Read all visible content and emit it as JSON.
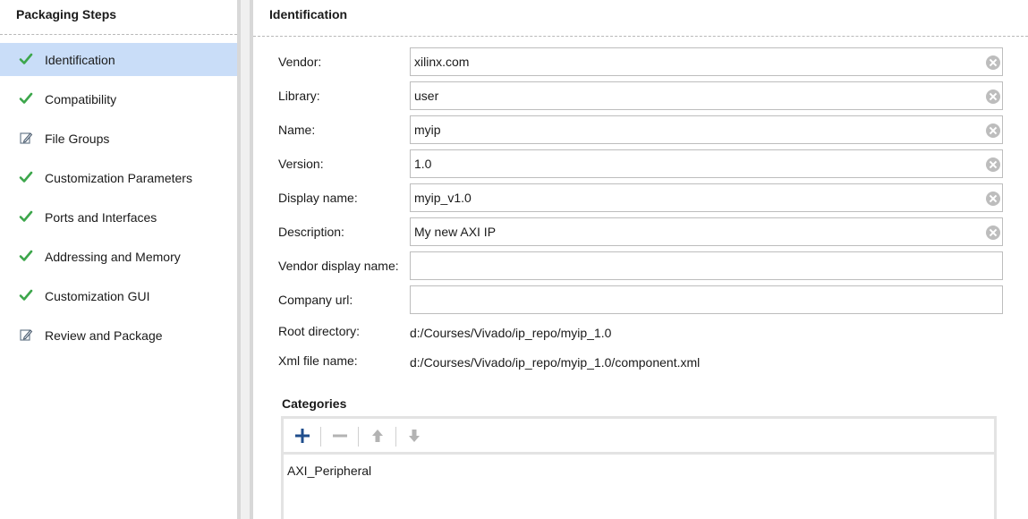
{
  "left": {
    "title": "Packaging Steps",
    "steps": [
      {
        "label": "Identification",
        "icon": "check-icon",
        "selected": true
      },
      {
        "label": "Compatibility",
        "icon": "check-icon"
      },
      {
        "label": "File Groups",
        "icon": "edit-icon"
      },
      {
        "label": "Customization Parameters",
        "icon": "check-icon"
      },
      {
        "label": "Ports and Interfaces",
        "icon": "check-icon"
      },
      {
        "label": "Addressing and Memory",
        "icon": "check-icon"
      },
      {
        "label": "Customization GUI",
        "icon": "check-icon"
      },
      {
        "label": "Review and Package",
        "icon": "edit-icon"
      }
    ]
  },
  "right": {
    "title": "Identification",
    "fields": [
      {
        "label": "Vendor:",
        "value": "xilinx.com"
      },
      {
        "label": "Library:",
        "value": "user"
      },
      {
        "label": "Name:",
        "value": "myip"
      },
      {
        "label": "Version:",
        "value": "1.0"
      },
      {
        "label": "Display name:",
        "value": "myip_v1.0"
      },
      {
        "label": "Description:",
        "value": "My new AXI IP"
      },
      {
        "label": "Vendor display name:",
        "value": ""
      },
      {
        "label": "Company url:",
        "value": ""
      }
    ],
    "root_directory": {
      "label": "Root directory:",
      "value": "d:/Courses/Vivado/ip_repo/myip_1.0"
    },
    "xml_file": {
      "label": "Xml file name:",
      "value": "d:/Courses/Vivado/ip_repo/myip_1.0/component.xml"
    },
    "categories": {
      "title": "Categories",
      "items": [
        "AXI_Peripheral"
      ]
    }
  },
  "colors": {
    "selected_bg": "#c9ddf8",
    "check_green": "#3ca64b",
    "add_blue": "#1f4d8c",
    "disabled_gray": "#b3b3b3"
  }
}
